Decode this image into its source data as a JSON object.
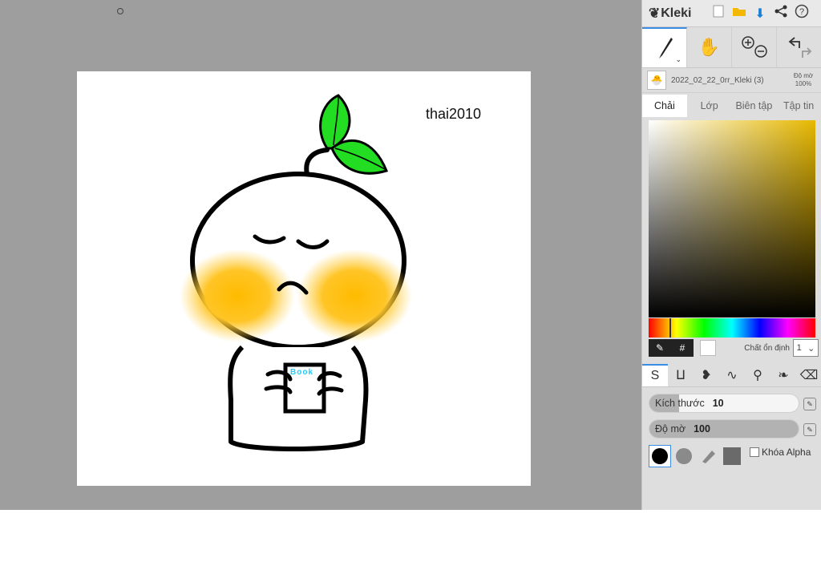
{
  "app": {
    "name": "Kleki"
  },
  "canvas": {
    "text": "thai2010",
    "book_label": "Book"
  },
  "toolbar": {
    "icons": [
      "new-file-icon",
      "open-folder-icon",
      "download-icon",
      "share-icon",
      "help-icon"
    ]
  },
  "document": {
    "name": "2022_02_22_0rr_Kleki (3)",
    "opacity_label": "Độ mờ",
    "opacity_value": "100%"
  },
  "tabs": [
    {
      "label": "Chải",
      "active": true
    },
    {
      "label": "Lớp"
    },
    {
      "label": "Biên tập"
    },
    {
      "label": "Tập tin"
    }
  ],
  "color": {
    "hex_label": "#",
    "stabilizer_label": "Chất ổn định",
    "stabilizer_value": "1",
    "accent": "#e6b800"
  },
  "sliders": {
    "size": {
      "label": "Kích thước",
      "value": "10",
      "fraction": 0.2
    },
    "opacity": {
      "label": "Độ mờ",
      "value": "100",
      "fraction": 1.0
    }
  },
  "alpha_lock": {
    "label": "Khóa Alpha",
    "checked": false
  }
}
